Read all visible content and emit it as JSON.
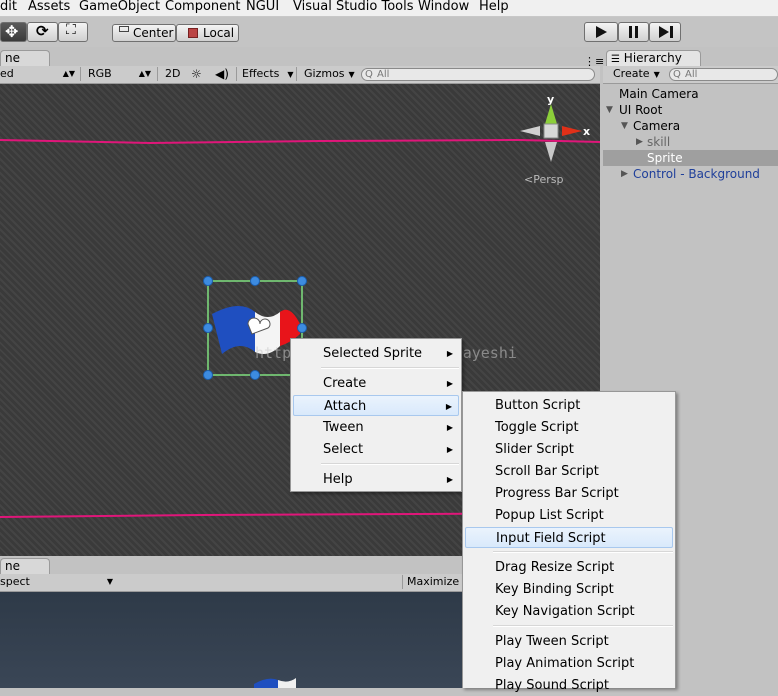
{
  "menubar": [
    "dit",
    "Assets",
    "GameObject",
    "Component",
    "NGUI",
    "Visual Studio Tools",
    "Window",
    "Help"
  ],
  "toolbar": {
    "center_label": "Center",
    "local_label": "Local"
  },
  "scene": {
    "tab_label": "ne",
    "shading": "ed",
    "rgb": "RGB",
    "mode_2d": "2D",
    "effects": "Effects",
    "gizmos": "Gizmos",
    "search_placeholder": "All",
    "persp_label": "Persp",
    "axis_y": "y",
    "axis_x": "x",
    "watermark": "http://blog.csdn.net/alayeshi"
  },
  "game": {
    "tab_label": "ne",
    "aspect": "spect",
    "maximize": "Maximize o"
  },
  "hierarchy": {
    "tab_label": "Hierarchy",
    "create_label": "Create",
    "search_placeholder": "All",
    "items": [
      {
        "label": "Main Camera",
        "indent": 0,
        "arrow": "",
        "selected": false,
        "blue": false
      },
      {
        "label": "UI Root",
        "indent": 0,
        "arrow": "down",
        "selected": false,
        "blue": false
      },
      {
        "label": "Camera",
        "indent": 1,
        "arrow": "down",
        "selected": false,
        "blue": false
      },
      {
        "label": "skill",
        "indent": 2,
        "arrow": "right",
        "selected": false,
        "blue": false,
        "grey": true
      },
      {
        "label": "Sprite",
        "indent": 2,
        "arrow": "",
        "selected": true,
        "blue": false
      },
      {
        "label": "Control - Background",
        "indent": 1,
        "arrow": "right",
        "selected": false,
        "blue": true
      }
    ]
  },
  "context_menu": {
    "items": [
      {
        "label": "Selected Sprite",
        "submenu": true
      },
      {
        "label": "Create",
        "submenu": true
      },
      {
        "label": "Attach",
        "submenu": true,
        "highlighted": true
      },
      {
        "label": "Tween",
        "submenu": true
      },
      {
        "label": "Select",
        "submenu": true
      },
      {
        "label": "Help",
        "submenu": true
      }
    ]
  },
  "attach_menu": {
    "items": [
      "Button Script",
      "Toggle Script",
      "Slider Script",
      "Scroll Bar Script",
      "Progress Bar Script",
      "Popup List Script",
      "Input Field Script",
      "Drag Resize Script",
      "Key Binding Script",
      "Key Navigation Script",
      "Play Tween Script",
      "Play Animation Script",
      "Play Sound Script"
    ],
    "highlighted": "Input Field Script"
  },
  "colors": {
    "accent_line": "#e0167a",
    "selection": "#9f9f9f",
    "hierarchy_blue": "#1f3f9a"
  }
}
